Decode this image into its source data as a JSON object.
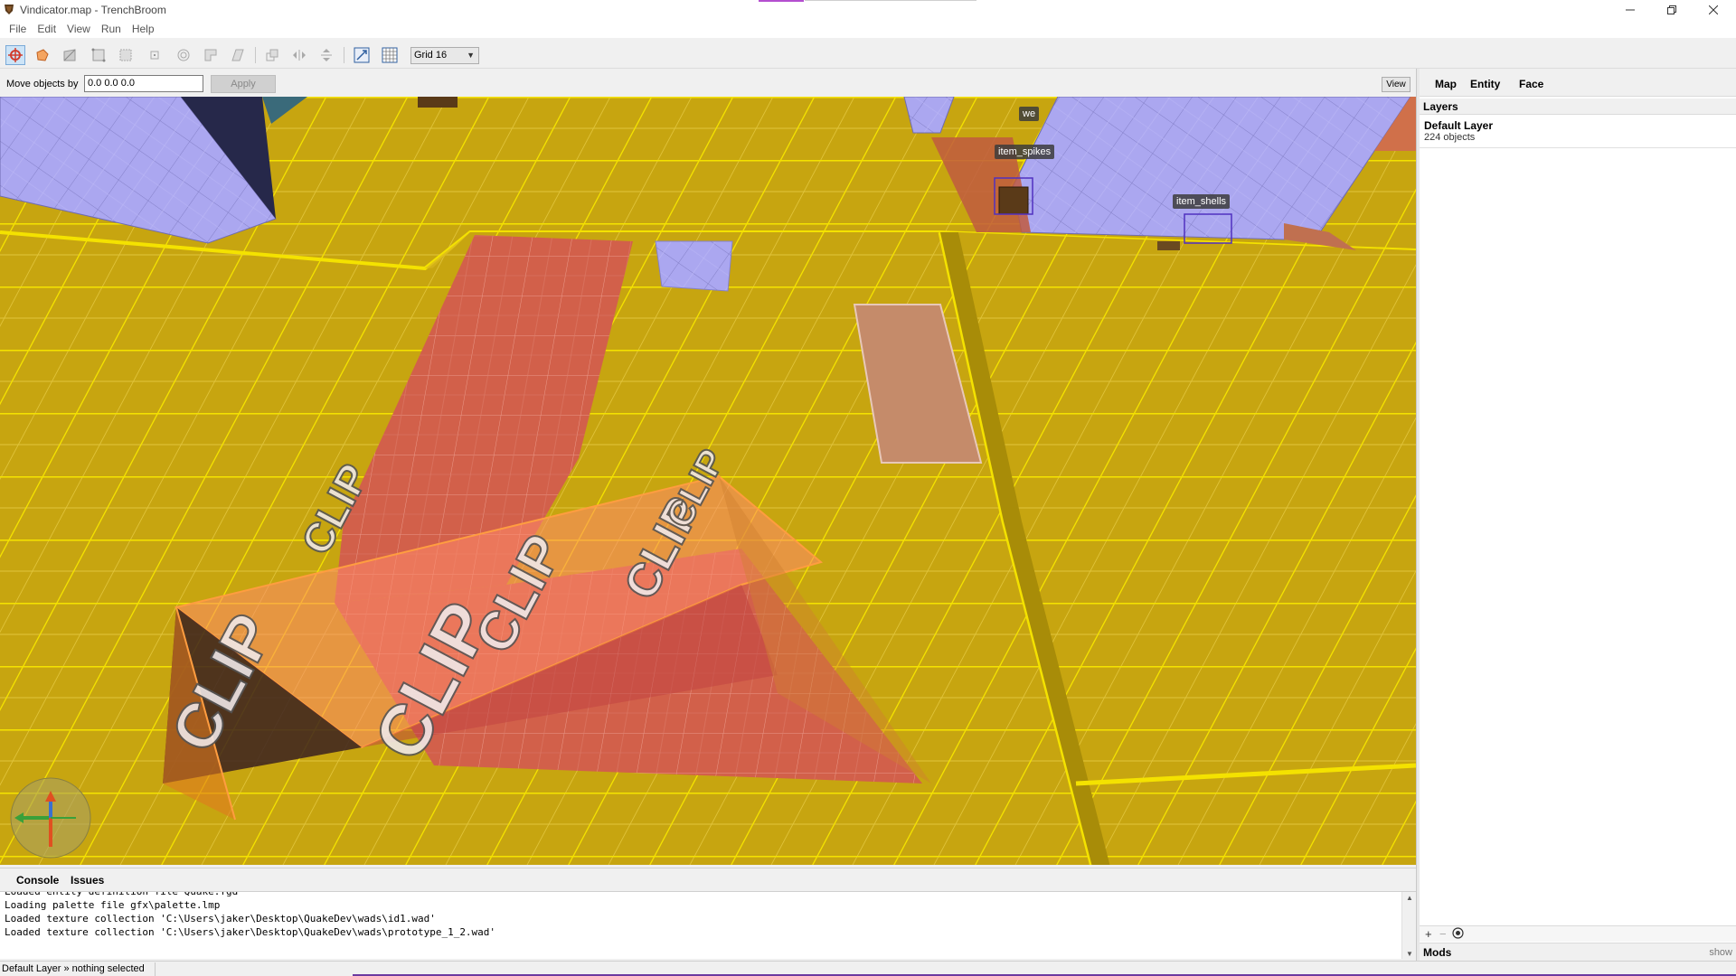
{
  "window": {
    "title": "Vindicator.map - TrenchBroom",
    "controls": [
      "minimize-icon",
      "restore-icon",
      "close-icon"
    ]
  },
  "menu": [
    "File",
    "Edit",
    "View",
    "Run",
    "Help"
  ],
  "toolbar": {
    "tools": [
      "move-tool-icon",
      "rotate-tool-icon",
      "clip-tool-icon",
      "vertex-tool-icon",
      "edge-tool-icon",
      "face-tool-icon",
      "brush-tool-icon",
      "cylinder-tool-icon",
      "flip-tool-icon",
      "shear-tool-icon",
      "duplicate-icon",
      "flip-horizontal-icon",
      "flip-vertical-icon",
      "texture-lock-icon",
      "uv-lock-icon"
    ],
    "grid_label": "Grid 16"
  },
  "movebar": {
    "label": "Move objects by",
    "value": "0.0 0.0 0.0",
    "apply_label": "Apply",
    "view_label": "View"
  },
  "viewport": {
    "entity_labels": [
      "item_spikes",
      "item_shells",
      "we"
    ],
    "texture_text": "CLIP",
    "colors": {
      "floor": "#c9a712",
      "grid": "#f2e100",
      "wall": "#a9a6ef",
      "clip": "#d96a62"
    }
  },
  "right_panel": {
    "tabs": [
      "Map",
      "Entity",
      "Face"
    ],
    "layers_header": "Layers",
    "layer_name": "Default Layer",
    "layer_count": "224 objects",
    "mods_label": "Mods",
    "mods_show": "show"
  },
  "console": {
    "tabs": [
      "Console",
      "Issues"
    ],
    "lines": [
      "Loaded entity definition file Quake.fgd",
      "Loading palette file gfx\\palette.lmp",
      "Loaded texture collection 'C:\\Users\\jaker\\Desktop\\QuakeDev\\wads\\id1.wad'",
      "Loaded texture collection 'C:\\Users\\jaker\\Desktop\\QuakeDev\\wads\\prototype_1_2.wad'"
    ]
  },
  "status": {
    "text": "Default Layer » nothing selected"
  }
}
